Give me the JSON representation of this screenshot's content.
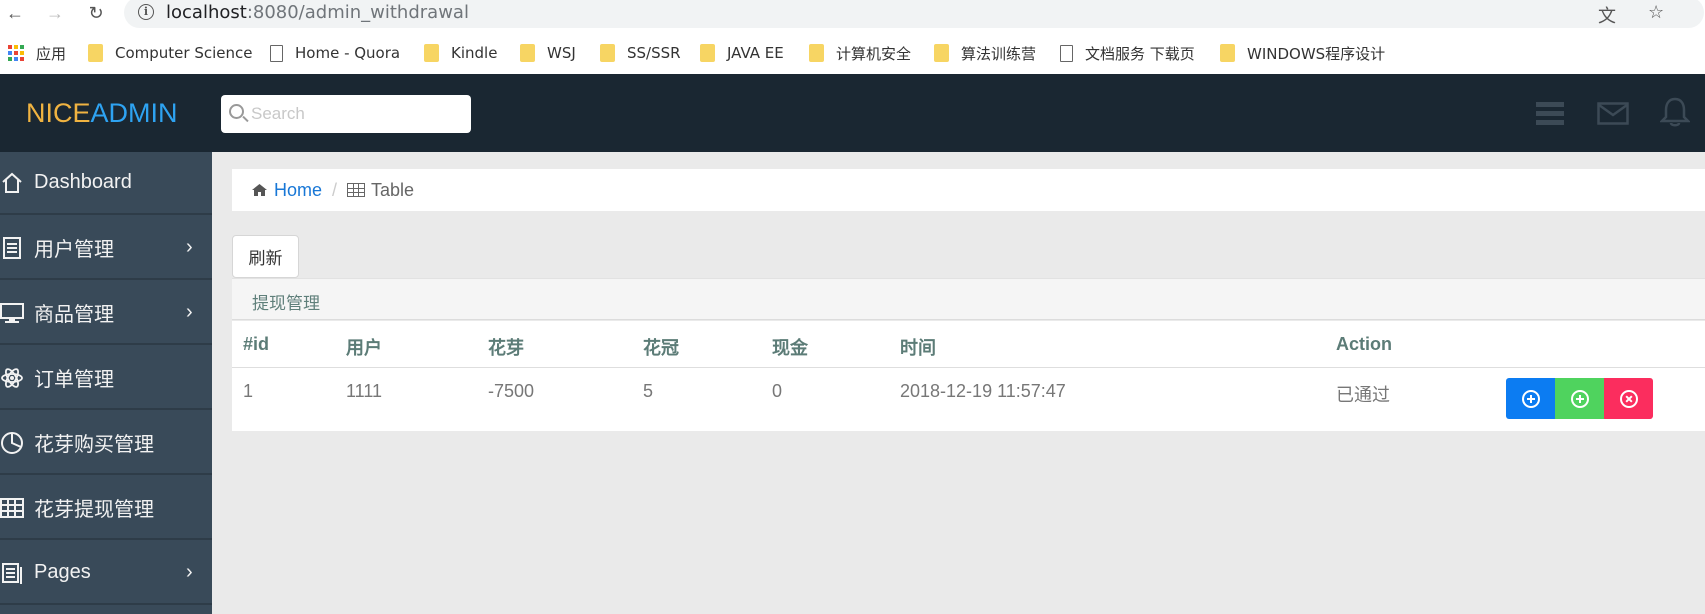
{
  "browser": {
    "url_host": "localhost",
    "url_rest": ":8080/admin_withdrawal",
    "bookmarks": [
      "应用",
      "Computer Science",
      "Home - Quora",
      "Kindle",
      "WSJ",
      "SS/SSR",
      "JAVA EE",
      "计算机安全",
      "算法训练营",
      "文档服务 下载页",
      "WINDOWS程序设计"
    ]
  },
  "header": {
    "logo_nice": "NICE",
    "logo_admin": "ADMIN",
    "search_placeholder": "Search"
  },
  "sidebar": {
    "items": [
      {
        "label": "Dashboard",
        "icon": "home-icon",
        "has_chevron": false
      },
      {
        "label": "用户管理",
        "icon": "document-icon",
        "has_chevron": true
      },
      {
        "label": "商品管理",
        "icon": "monitor-icon",
        "has_chevron": true
      },
      {
        "label": "订单管理",
        "icon": "atom-icon",
        "has_chevron": false
      },
      {
        "label": "花芽购买管理",
        "icon": "pie-chart-icon",
        "has_chevron": false
      },
      {
        "label": "花芽提现管理",
        "icon": "table-icon",
        "has_chevron": false
      },
      {
        "label": "Pages",
        "icon": "pages-icon",
        "has_chevron": true
      }
    ],
    "chevron": "›"
  },
  "breadcrumb": {
    "home": "Home",
    "separator": "/",
    "current": "Table"
  },
  "toolbar": {
    "refresh_label": "刷新"
  },
  "panel": {
    "title": "提现管理"
  },
  "table": {
    "headers": [
      "#id",
      "用户",
      "花芽",
      "花冠",
      "现金",
      "时间",
      "Action"
    ],
    "rows": [
      [
        "1",
        "1111",
        "-7500",
        "5",
        "0",
        "2018-12-19 11:57:47",
        "已通过"
      ]
    ]
  },
  "colors": {
    "header_bg": "#1a2732",
    "sidebar_bg": "#394a59",
    "logo_nice": "#f0b341",
    "logo_admin": "#2ea3f2",
    "link": "#1877d6",
    "btn_blue": "#0c7cf2",
    "btn_green": "#4fd35e",
    "btn_red": "#fb2d5e"
  }
}
